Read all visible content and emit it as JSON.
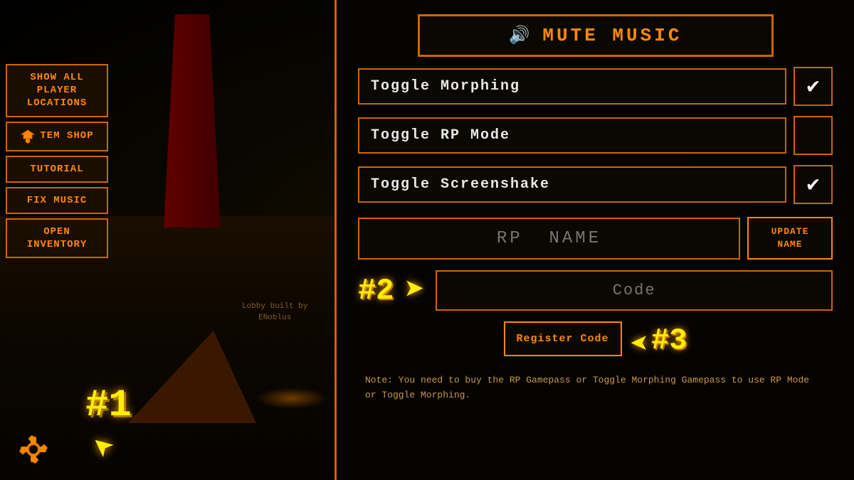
{
  "background": {
    "lobby_text_line1": "Lobby built by",
    "lobby_text_line2": "ENoblus"
  },
  "sidebar": {
    "show_all_label": "Show All Player Locations",
    "tem_shop_label": "TEM SHOP",
    "tutorial_label": "Tutorial",
    "fix_music_label": "Fix Music",
    "open_inventory_label": "OPEN INVENTORY"
  },
  "panel": {
    "mute_music_label": "MUTE MUSIC",
    "toggle_morphing_label": "Toggle Morphing",
    "toggle_morphing_checked": true,
    "toggle_rp_mode_label": "Toggle RP Mode",
    "toggle_rp_mode_checked": false,
    "toggle_screenshake_label": "Toggle Screenshake",
    "toggle_screenshake_checked": true,
    "rp_name_placeholder": "RP  NAME",
    "update_name_label": "UPDATE NAME",
    "code_placeholder": "Code",
    "register_code_label": "Register Code",
    "note_text": "Note:  You need to buy the RP Gamepass or Toggle Morphing Gamepass to use RP Mode or Toggle Morphing."
  },
  "annotations": {
    "label_1": "#1",
    "label_2": "#2",
    "label_3": "#3"
  },
  "icons": {
    "speaker": "🔊",
    "checkmark": "✔",
    "gear": "⚙",
    "arrow_right": "➤",
    "arrow_left": "➤"
  }
}
